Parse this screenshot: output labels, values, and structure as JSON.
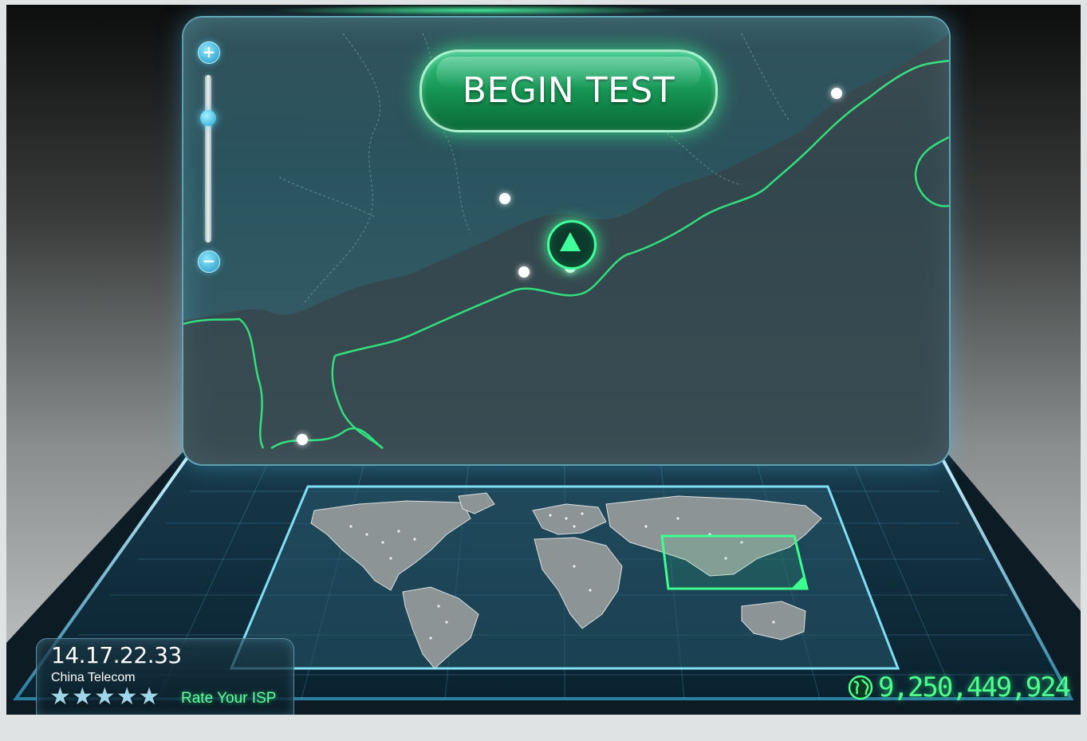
{
  "app": {
    "begin_button_label": "BEGIN TEST"
  },
  "zoom": {
    "in_symbol": "+",
    "out_symbol": "−",
    "level": 0.75
  },
  "connection": {
    "ip_address": "14.17.22.33",
    "isp_name": "China Telecom",
    "rating_stars": 5,
    "star_glyph": "★",
    "rate_link_label": "Rate Your ISP"
  },
  "stats": {
    "tests_count": "9,250,449,924"
  },
  "colors": {
    "accent_green": "#41ff9a",
    "screen_teal": "#2b5560",
    "glow_cyan": "#8ce6ff"
  },
  "icons": {
    "zoom_in": "plus-icon",
    "zoom_out": "minus-icon",
    "user_location": "triangle-marker-icon",
    "globe": "globe-icon",
    "star": "star-icon"
  }
}
